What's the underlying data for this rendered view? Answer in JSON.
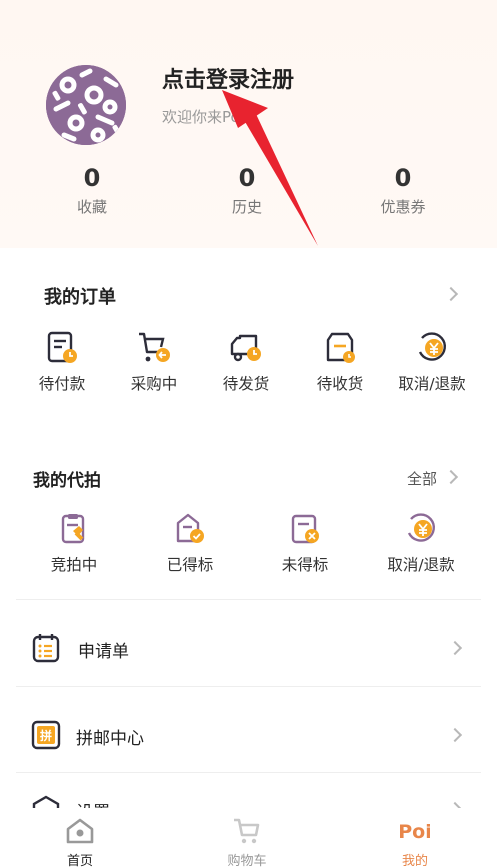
{
  "profile": {
    "login_title": "点击登录注册",
    "welcome": "欢迎你来Poi~"
  },
  "stats": [
    {
      "value": "0",
      "label": "收藏"
    },
    {
      "value": "0",
      "label": "历史"
    },
    {
      "value": "0",
      "label": "优惠券"
    }
  ],
  "orders": {
    "title": "我的订单",
    "items": [
      {
        "label": "待付款",
        "icon": "payment-pending-icon"
      },
      {
        "label": "采购中",
        "icon": "cart-purchasing-icon"
      },
      {
        "label": "待发货",
        "icon": "delivery-truck-icon"
      },
      {
        "label": "待收货",
        "icon": "package-receive-icon"
      },
      {
        "label": "取消/退款",
        "icon": "yen-refund-icon"
      }
    ]
  },
  "auction": {
    "title": "我的代拍",
    "all_label": "全部",
    "items": [
      {
        "label": "竞拍中",
        "icon": "bidding-icon"
      },
      {
        "label": "已得标",
        "icon": "won-check-icon"
      },
      {
        "label": "未得标",
        "icon": "lost-x-icon"
      },
      {
        "label": "取消/退款",
        "icon": "yen-refund-icon"
      }
    ]
  },
  "menu": [
    {
      "label": "申请单",
      "icon": "application-list-icon"
    },
    {
      "label": "拼邮中心",
      "icon": "group-mail-icon"
    },
    {
      "label": "设置",
      "icon": "settings-icon"
    }
  ],
  "tabbar": [
    {
      "label": "首页",
      "icon": "home-icon"
    },
    {
      "label": "购物车",
      "icon": "cart-icon"
    },
    {
      "label": "我的",
      "icon": "poi-logo-icon"
    }
  ],
  "colors": {
    "accent": "#f5a623",
    "brand_orange": "#e8864a",
    "dark_icon": "#2d2d3a",
    "avatar_purple": "#8c6a96",
    "annotation_red": "#e8232f"
  }
}
